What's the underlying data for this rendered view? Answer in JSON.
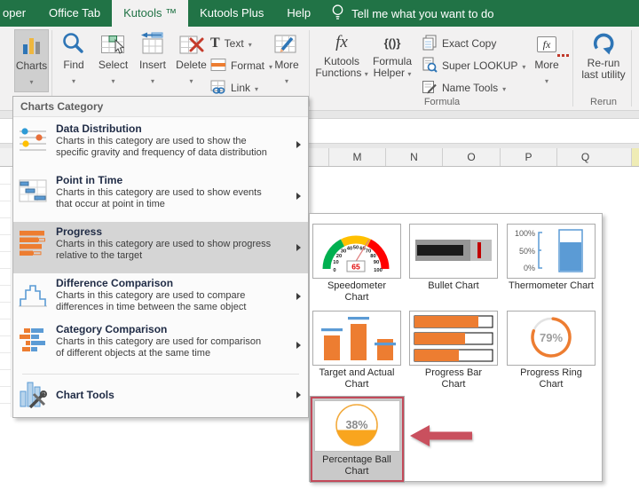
{
  "titlebar": {
    "tabs": [
      "oper",
      "Office Tab",
      "Kutools ™",
      "Kutools Plus",
      "Help"
    ],
    "tellme": "Tell me what you want to do"
  },
  "ribbon": {
    "charts": "Charts",
    "find": "Find",
    "select": "Select",
    "insert": "Insert",
    "delete": "Delete",
    "text": "Text",
    "format": "Format",
    "link": "Link",
    "more_left": "More",
    "kutools_functions_1": "Kutools",
    "kutools_functions_2": "Functions",
    "formula_helper_1": "Formula",
    "formula_helper_2": "Helper",
    "exact_copy": "Exact Copy",
    "super_lookup": "Super LOOKUP",
    "name_tools": "Name Tools",
    "more_formula": "More",
    "rerun_1": "Re-run",
    "rerun_2": "last utility",
    "group_formula": "Formula",
    "group_rerun": "Rerun"
  },
  "sheet": {
    "columns": [
      "M",
      "N",
      "O",
      "P",
      "Q"
    ]
  },
  "menu": {
    "header": "Charts Category",
    "items": [
      {
        "title": "Data Distribution",
        "desc1": "Charts in this category are used to show the",
        "desc2": "specific gravity and frequency of data distribution"
      },
      {
        "title": "Point in Time",
        "desc1": "Charts in this category are used to show events",
        "desc2": "that occur at point in time"
      },
      {
        "title": "Progress",
        "desc1": "Charts in this category are used to show progress",
        "desc2": "relative to the target"
      },
      {
        "title": "Difference Comparison",
        "desc1": "Charts in this category are used to compare",
        "desc2": "differences in time between the same object"
      },
      {
        "title": "Category Comparison",
        "desc1": "Charts in this category are used for comparison",
        "desc2": "of different objects at the same time"
      }
    ],
    "tools_title": "Chart Tools"
  },
  "submenu": {
    "charts": [
      "Speedometer Chart",
      "Bullet Chart",
      "Thermometer Chart",
      "Target and Actual Chart",
      "Progress Bar Chart",
      "Progress Ring Chart",
      "Percentage Ball Chart"
    ],
    "speedometer": {
      "ticks": [
        "0",
        "10",
        "20",
        "30",
        "40",
        "50",
        "60",
        "70",
        "80",
        "90",
        "100"
      ],
      "value": "65"
    },
    "thermometer": {
      "labels": [
        "100%",
        "50%",
        "0%"
      ]
    },
    "ring": {
      "value": "79%"
    },
    "ball": {
      "value": "38%"
    }
  },
  "colors": {
    "excel_green": "#217346",
    "orange": "#ED7D31",
    "blue": "#5B9BD5",
    "selection_red": "#C34A5A",
    "arrow_red": "#C9505E",
    "gauge_green": "#00B050",
    "gauge_yellow": "#FFC000",
    "gauge_red": "#FF0000"
  }
}
